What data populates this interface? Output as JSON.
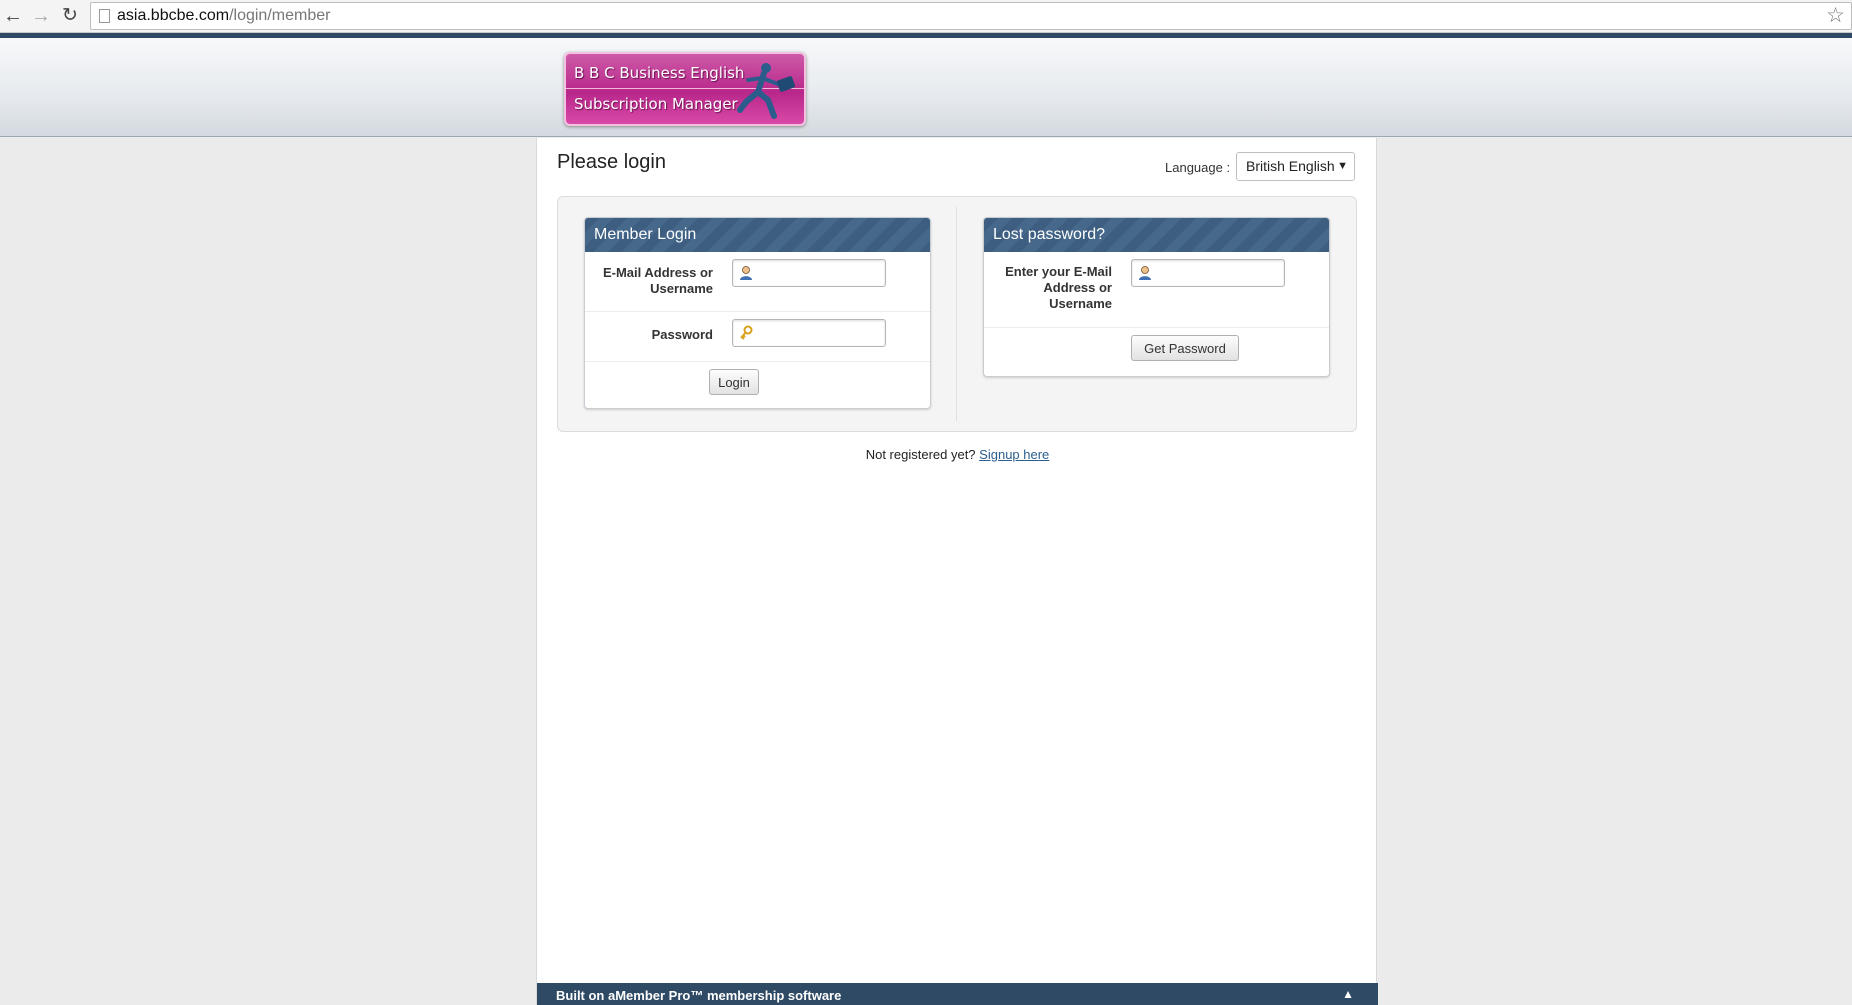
{
  "browser": {
    "url_host": "asia.bbcbe.com",
    "url_path": "/login/member",
    "back_glyph": "←",
    "forward_glyph": "→",
    "reload_glyph": "↻",
    "star_glyph": "☆"
  },
  "logo": {
    "line1": "B B C Business English",
    "line2": "Subscription Manager"
  },
  "page": {
    "title": "Please login",
    "language_label": "Language :",
    "language_value": "British English",
    "dropdown_glyph": "▼"
  },
  "member_login": {
    "heading": "Member Login",
    "username_label_1": "E-Mail Address or",
    "username_label_2": "Username",
    "username_value": "",
    "password_label": "Password",
    "password_value": "",
    "login_button": "Login"
  },
  "lost_password": {
    "heading": "Lost password?",
    "label_1": "Enter your E-Mail",
    "label_2": "Address or",
    "label_3": "Username",
    "value": "",
    "button": "Get Password"
  },
  "signup": {
    "text": "Not registered yet?",
    "link": "Signup here"
  },
  "footer": {
    "text": "Built on aMember Pro™ membership software",
    "up_glyph": "▲"
  },
  "colors": {
    "header_dark": "#2e4a66",
    "box_head": "#3d5e80",
    "logo_pink": "#b8278a",
    "link": "#2b5d8d"
  }
}
